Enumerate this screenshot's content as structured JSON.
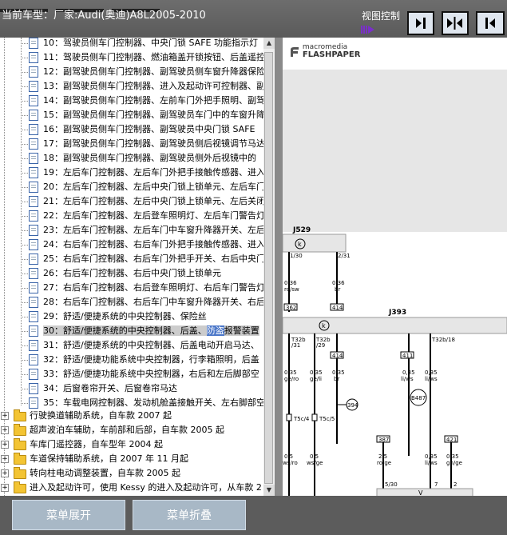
{
  "header": {
    "car_title": "当前车型：厂家:Audi(奥迪)A8L2005-2010",
    "view_control_label": "视图控制"
  },
  "view_buttons": [
    "collapse-left",
    "split",
    "expand-left"
  ],
  "tree": {
    "doc_items": [
      {
        "label": "10：驾驶员侧车门控制器、中央门锁 SAFE 功能指示灯"
      },
      {
        "label": "11：驾驶员侧车门控制器、燃油箱盖开锁按钮、后盖遥控"
      },
      {
        "label": "12：副驾驶员侧车门控制器、副驾驶员侧车窗升降器保险"
      },
      {
        "label": "13：副驾驶员侧车门控制器、进入及起动许可控制器、副"
      },
      {
        "label": "14：副驾驶员侧车门控制器、左前车门外把手照明、副驾"
      },
      {
        "label": "15：副驾驶员侧车门控制器、副驾驶员车门中的车窗升降"
      },
      {
        "label": "16：副驾驶员侧车门控制器、副驾驶员中央门锁 SAFE"
      },
      {
        "label": "17：副驾驶员侧车门控制器、副驾驶员侧后视镜调节马达"
      },
      {
        "label": "18：副驾驶员侧车门控制器、副驾驶员侧外后视镜中的"
      },
      {
        "label": "19：左后车门控制器、左后车门外把手接触传感器、进入"
      },
      {
        "label": "20：左后车门控制器、左后中央门锁上锁单元、左后车门"
      },
      {
        "label": "21：左后车门控制器、左后中央门锁上锁单元、左后关闭"
      },
      {
        "label": "22：左后车门控制器、左后登车照明灯、左后车门警告灯"
      },
      {
        "label": "23：左后车门控制器、左后车门中车窗升降器开关、左后"
      },
      {
        "label": "24：右后车门控制器、右后车门外把手接触传感器、进入"
      },
      {
        "label": "25：右后车门控制器、右后车门外把手开关、右后中央门"
      },
      {
        "label": "26：右后车门控制器、右后中央门锁上锁单元"
      },
      {
        "label": "27：右后车门控制器、右后登车照明灯、右后车门警告灯"
      },
      {
        "label": "28：右后车门控制器、右后车门中车窗升降器开关、右后"
      },
      {
        "label": "29：舒适/便捷系统的中央控制器、保险丝"
      },
      {
        "label_before": "30：舒适/便捷系统的中央控制器、后盖、",
        "label_highlight": "防盗",
        "label_after": "报警装置",
        "selected": true
      },
      {
        "label": "31：舒适/便捷系统的中央控制器、后盖电动开启马达、"
      },
      {
        "label": "32：舒适/便捷功能系统中央控制器，行李箱照明，后盖"
      },
      {
        "label": "33：舒适/便捷功能系统中央控制器，右后和左后脚部空"
      },
      {
        "label": "34：后窗卷帘开关、后窗卷帘马达"
      },
      {
        "label": "35：车载电网控制器、发动机舱盖接触开关、左右脚部空"
      }
    ],
    "folders": [
      {
        "label": "行驶换道辅助系统，自车款 2007 起"
      },
      {
        "label": "超声波泊车辅助，车前部和后部，自车款 2005 起"
      },
      {
        "label": "车库门遥控器，自车型年 2004 起"
      },
      {
        "label": "车道保持辅助系统，自 2007 年 11 月起"
      },
      {
        "label": "转向柱电动调整装置，自车款 2005 起"
      },
      {
        "label": "进入及起动许可，使用 Kessy 的进入及起动许可，从车款 2"
      }
    ]
  },
  "viewer": {
    "logo_top": "macromedia",
    "logo_bottom": "FLASHPAPER",
    "labels": {
      "j529": "J529",
      "j393": "J393",
      "t1_30": "1/30",
      "t2_31": "2/31",
      "w036a": "0,36",
      "w036b": "0,36",
      "c_ro_sw": "ro/sw",
      "c_br": "br",
      "box362": "362",
      "box414": "414",
      "t32b_a": "T32b",
      "t32b_a2": "/31",
      "t32b_b": "T32b",
      "t32b_b2": "/29",
      "box414b": "414",
      "box411": "411",
      "t32b18": "T32b/18",
      "w035a": "0,35",
      "w035b": "0,35",
      "w035c": "0,35",
      "w035d": "0,35",
      "w035e": "0,35",
      "c_ge_ro": "ge/ro",
      "c_ge_li": "ge/li",
      "c_br2": "br",
      "c_li_ws": "li/ws",
      "c_li_ws2": "li/ws",
      "c_gn_ge": "gn/ge",
      "b487": "B487",
      "b394": "394",
      "t5c4": "T5c/4",
      "t5c5": "T5c/5",
      "box387": "387",
      "box421": "421",
      "w05a": "0,5",
      "w05b": "0,5",
      "w25": "2,5",
      "w035f": "0,35",
      "w035g": "0,35",
      "c_ws_ro": "ws/ro",
      "c_ws_ge": "ws/ge",
      "c_ro_ge": "ro/ge",
      "c_li_ws3": "li/ws",
      "c_gn_ge2": "gn/ge",
      "n5_30": "5/30",
      "n7": "7",
      "n2": "2",
      "vxx": "V   "
    }
  },
  "bottom": {
    "expand_label": "菜单展开",
    "collapse_label": "菜单折叠"
  },
  "colors": {
    "highlight": "#4a76c8",
    "button_bg": "#a8b8c6",
    "purple_arrow": "#7a2fc9"
  }
}
